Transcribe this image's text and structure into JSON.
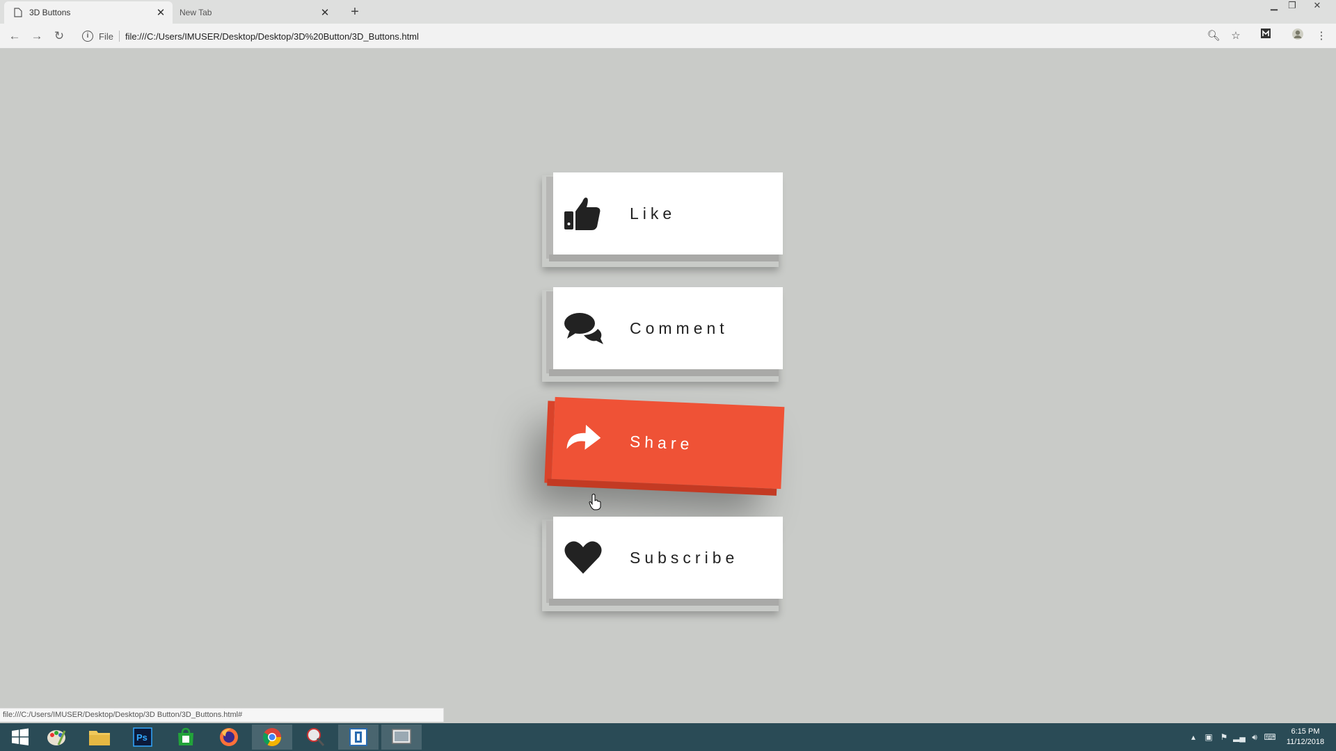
{
  "browser": {
    "tabs": [
      {
        "title": "3D Buttons",
        "active": true
      },
      {
        "title": "New Tab",
        "active": false
      }
    ],
    "address": {
      "security_label": "File",
      "url": "file:///C:/Users/IMUSER/Desktop/Desktop/3D%20Button/3D_Buttons.html"
    },
    "status_url": "file:///C:/Users/IMUSER/Desktop/Desktop/3D Button/3D_Buttons.html#"
  },
  "page": {
    "buttons": [
      {
        "label": "Like",
        "icon": "thumbs-up-icon",
        "active": false
      },
      {
        "label": "Comment",
        "icon": "comments-icon",
        "active": false
      },
      {
        "label": "Share",
        "icon": "share-icon",
        "active": true
      },
      {
        "label": "Subscribe",
        "icon": "heart-icon",
        "active": false
      }
    ],
    "colors": {
      "background": "#c9cbc8",
      "button": "#ffffff",
      "active_button": "#ef5236"
    }
  },
  "taskbar": {
    "apps": [
      "windows-start-icon",
      "paint-app-icon",
      "file-explorer-icon",
      "photoshop-icon",
      "store-icon",
      "firefox-icon",
      "chrome-icon",
      "snipping-app-icon",
      "app-icon",
      "screen-recorder-icon"
    ],
    "ps_label": "Ps",
    "clock": {
      "time": "6:15 PM",
      "date": "11/12/2018"
    }
  }
}
